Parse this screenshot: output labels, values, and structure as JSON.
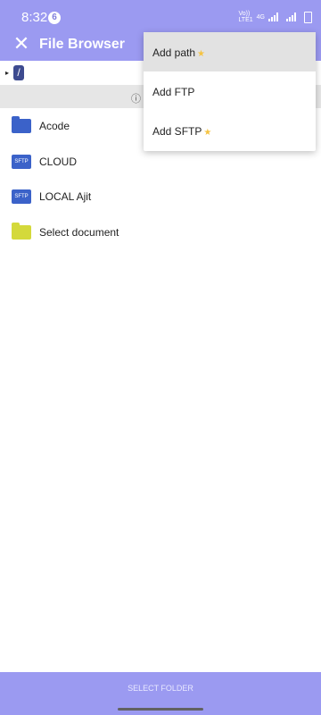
{
  "status_bar": {
    "time": "8:32",
    "notification_count": "6",
    "network_text_top": "Vo))",
    "network_text_bottom": "LTE1",
    "network_4g": "4G"
  },
  "app_bar": {
    "title": "File Browser",
    "close_icon": "close-icon"
  },
  "path": {
    "segment": "/"
  },
  "info_bar": {
    "text": "ⓘ F"
  },
  "files": [
    {
      "name": "Acode",
      "type": "folder",
      "color": "#3b62c9"
    },
    {
      "name": "CLOUD",
      "type": "sftp",
      "badge": "SFTP"
    },
    {
      "name": "LOCAL Ajit",
      "type": "sftp",
      "badge": "SFTP"
    },
    {
      "name": "Select document",
      "type": "folder",
      "color": "#d4d93b"
    }
  ],
  "menu": {
    "items": [
      {
        "label": "Add path",
        "star": "★"
      },
      {
        "label": "Add FTP",
        "star": ""
      },
      {
        "label": "Add SFTP",
        "star": "★"
      }
    ]
  },
  "bottom_bar": {
    "button_label": "SELECT FOLDER"
  },
  "colors": {
    "accent": "#9b9af1",
    "star": "#f5c342"
  }
}
